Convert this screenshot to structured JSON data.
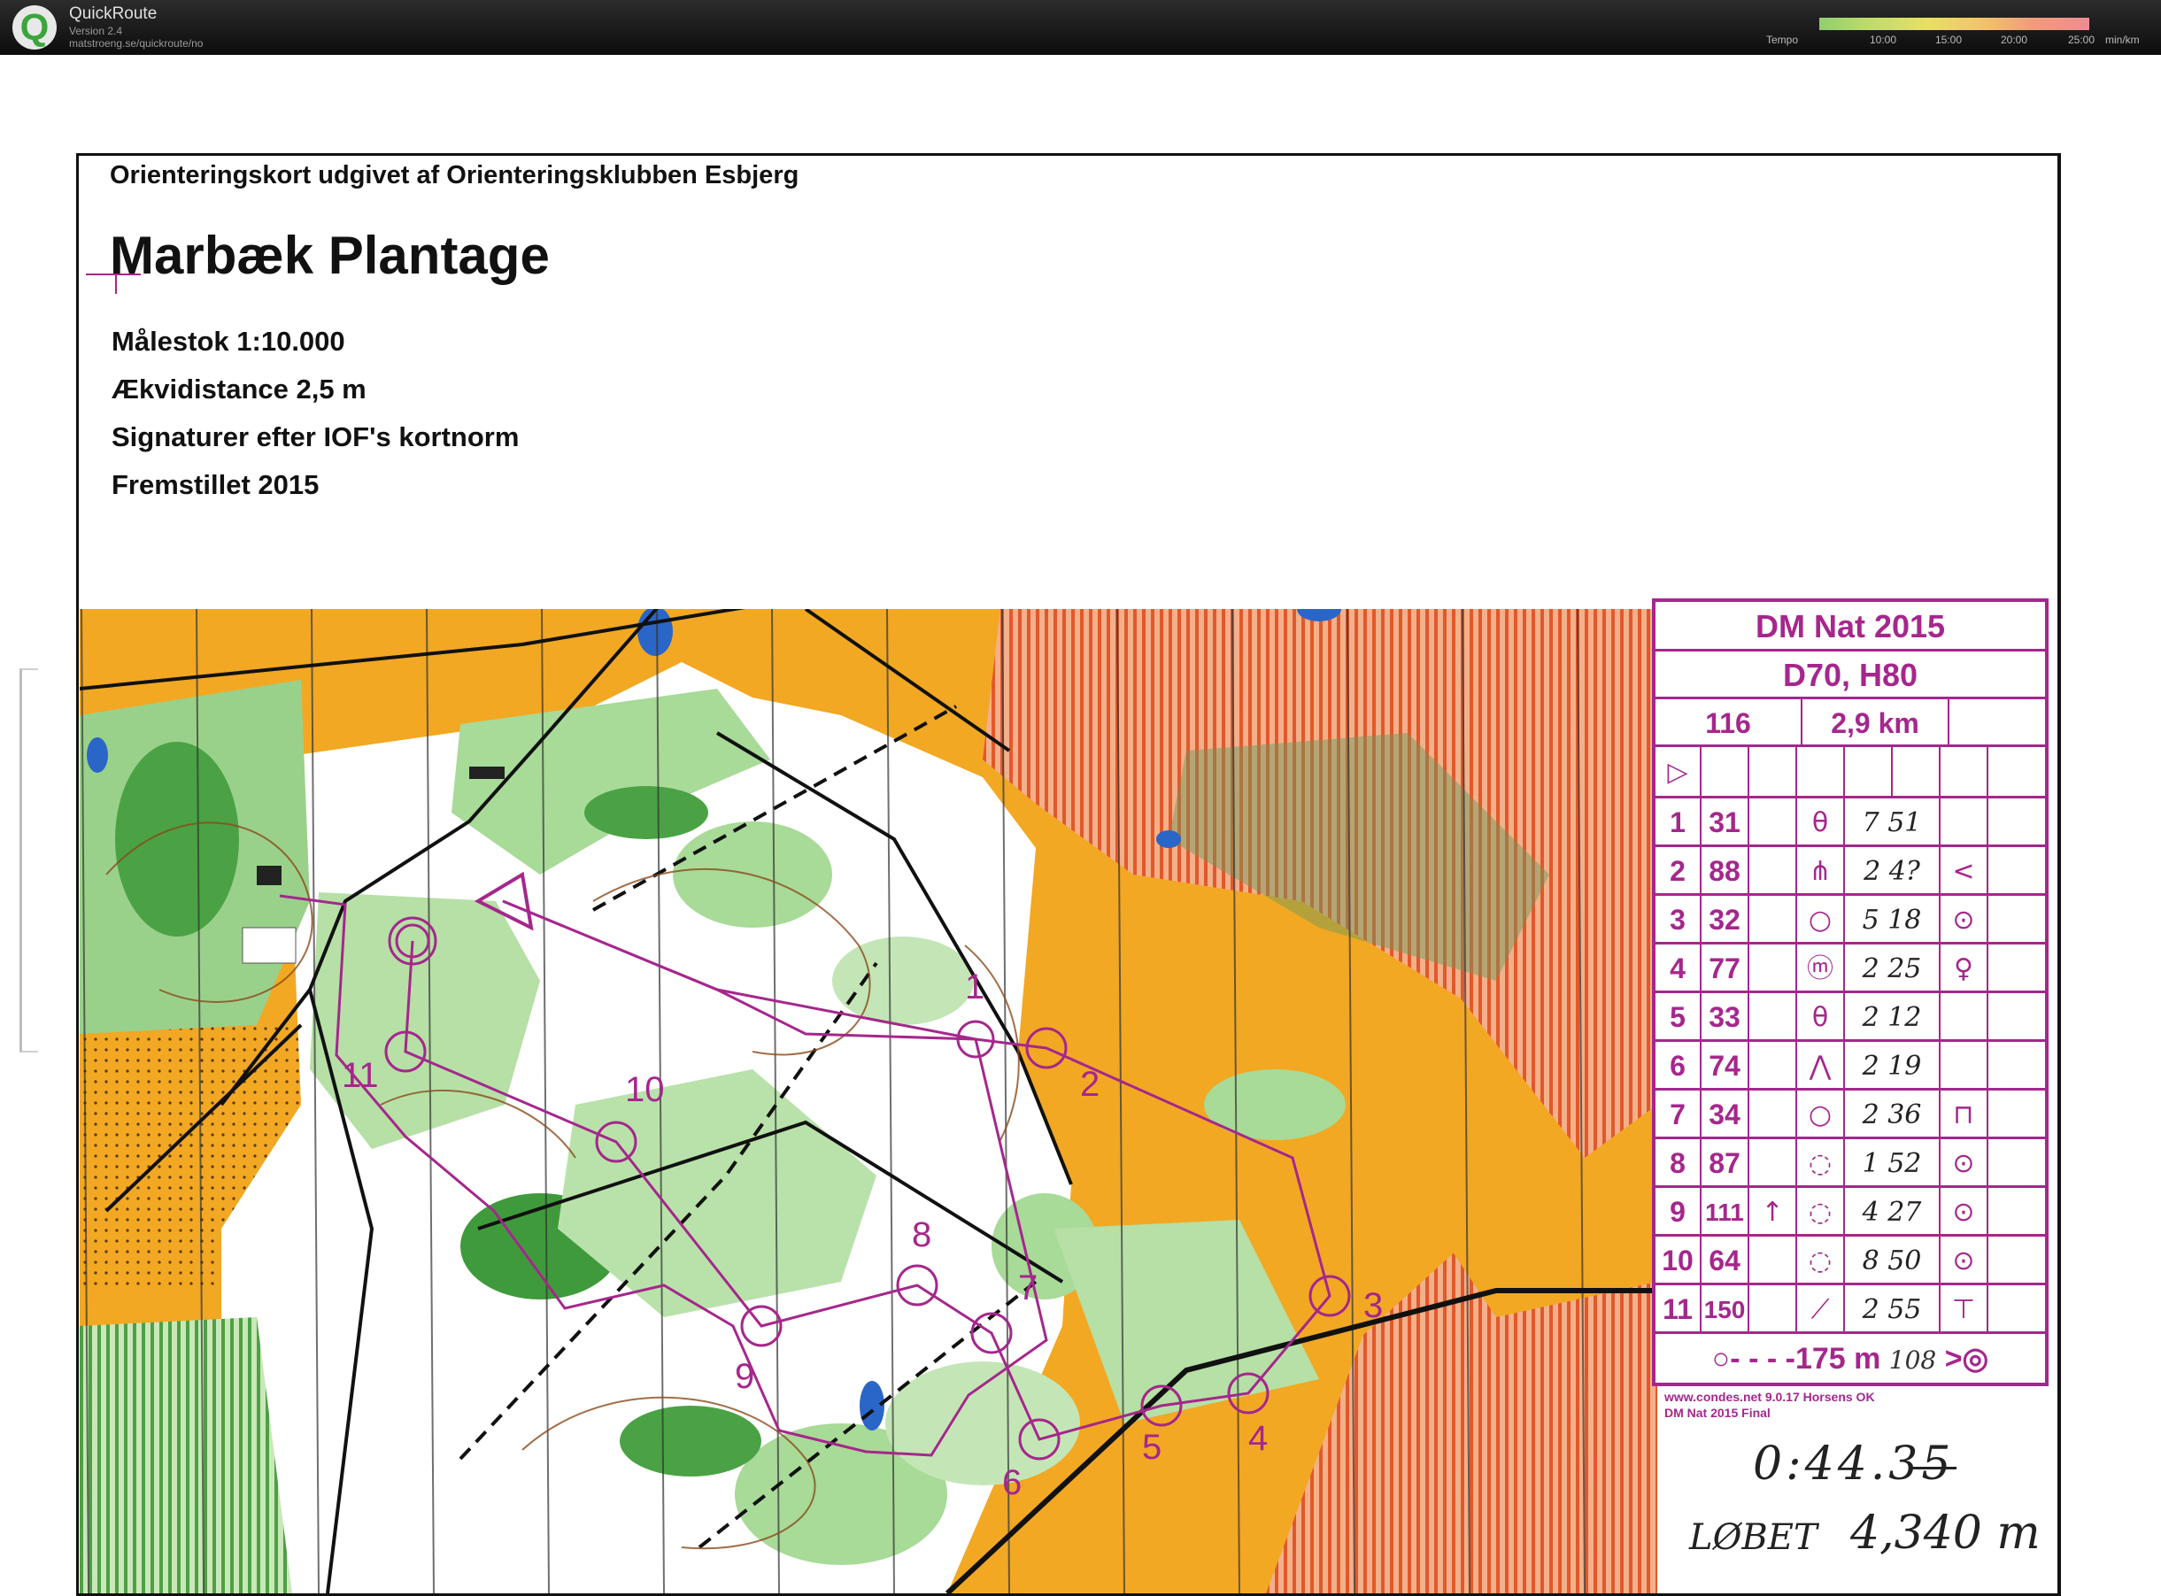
{
  "app": {
    "title": "QuickRoute",
    "version": "Version 2.4",
    "url": "matstroeng.se/quickroute/no",
    "logo_letter": "Q",
    "tempo_label": "Tempo",
    "tempo_ticks": [
      "10:00",
      "15:00",
      "20:00",
      "25:00"
    ],
    "tempo_unit": "min/km"
  },
  "map_header": {
    "publisher": "Orienteringskort udgivet af Orienteringsklubben Esbjerg",
    "title": "Marbæk Plantage",
    "scale": "Målestok 1:10.000",
    "contour": "Ækvidistance 2,5 m",
    "norm": "Signaturer efter IOF's kortnorm",
    "year": "Fremstillet 2015"
  },
  "course": {
    "control_numbers": [
      "1",
      "2",
      "3",
      "4",
      "5",
      "6",
      "7",
      "8",
      "9",
      "10",
      "11"
    ],
    "route_color": "#a5278c"
  },
  "description": {
    "event": "DM Nat 2015",
    "classes": "D70, H80",
    "course_code": "116",
    "length": "2,9 km",
    "start_symbol": "▷",
    "rows": [
      {
        "n": "1",
        "code": "31",
        "dir": "",
        "feat": "θ",
        "dim": "7 51",
        "loc": ""
      },
      {
        "n": "2",
        "code": "88",
        "dir": "",
        "feat": "⋔",
        "dim": "2 4?",
        "loc": "<"
      },
      {
        "n": "3",
        "code": "32",
        "dir": "",
        "feat": "○",
        "dim": "5 18",
        "loc": "⊙"
      },
      {
        "n": "4",
        "code": "77",
        "dir": "",
        "feat": "ⓜ",
        "dim": "2 25",
        "loc": "♀"
      },
      {
        "n": "5",
        "code": "33",
        "dir": "",
        "feat": "θ",
        "dim": "2 12",
        "loc": ""
      },
      {
        "n": "6",
        "code": "74",
        "dir": "",
        "feat": "⋀",
        "dim": "2 19",
        "loc": ""
      },
      {
        "n": "7",
        "code": "34",
        "dir": "",
        "feat": "○",
        "dim": "2 36",
        "loc": "⊓"
      },
      {
        "n": "8",
        "code": "87",
        "dir": "",
        "feat": "◌",
        "dim": "1 52",
        "loc": "⊙"
      },
      {
        "n": "9",
        "code": "111",
        "dir": "↑",
        "feat": "◌",
        "dim": "4 27",
        "loc": "⊙"
      },
      {
        "n": "10",
        "code": "64",
        "dir": "",
        "feat": "◌",
        "dim": "8 50",
        "loc": "⊙"
      },
      {
        "n": "11",
        "code": "150",
        "dir": "",
        "feat": "⟋",
        "dim": "2 55",
        "loc": "⊤"
      }
    ],
    "finish": "175 m",
    "finish_note": "108",
    "software": "www.condes.net 9.0.17 Horsens OK",
    "course_file": "DM Nat 2015 Final"
  },
  "result": {
    "time": "0:44.35",
    "run_label": "LØBET",
    "run_distance": "4,340 m"
  },
  "colors": {
    "open_land": "#f2a823",
    "forest_white": "#ffffff",
    "forest_green": "#8fcf80",
    "dark_green": "#3e9b3a",
    "out_of_bounds": "#e06a2e",
    "course": "#a5278c",
    "water": "#2a66c8"
  }
}
